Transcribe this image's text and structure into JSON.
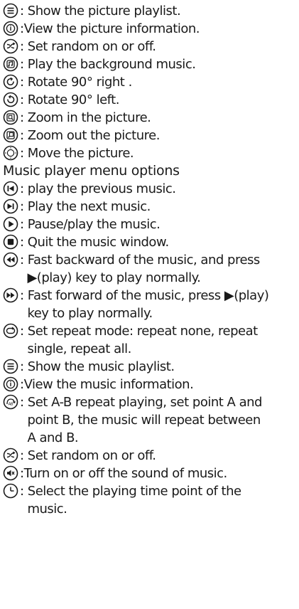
{
  "picture_section": [
    {
      "icon": "playlist-icon",
      "text": ": Show the picture playlist."
    },
    {
      "icon": "info-icon",
      "text": ":View the picture information."
    },
    {
      "icon": "random-icon",
      "text": ": Set random on or off."
    },
    {
      "icon": "music-note-icon",
      "text": ": Play the background music."
    },
    {
      "icon": "rotate-right-icon",
      "text": ": Rotate 90° right ."
    },
    {
      "icon": "rotate-left-icon",
      "text": ": Rotate 90° left."
    },
    {
      "icon": "zoom-in-icon",
      "text": ": Zoom in the picture."
    },
    {
      "icon": "zoom-out-icon",
      "text": ": Zoom out the picture."
    },
    {
      "icon": "move-icon",
      "text": ": Move the picture."
    }
  ],
  "music_heading": "Music player menu options",
  "music_section": [
    {
      "icon": "previous-icon",
      "text": ": play the previous music."
    },
    {
      "icon": "next-icon",
      "text": ": Play the next music."
    },
    {
      "icon": "play-pause-icon",
      "text": ": Pause/play the music."
    },
    {
      "icon": "stop-icon",
      "text": ": Quit the music window."
    },
    {
      "icon": "fast-backward-icon",
      "text": ": Fast backward of the music, and press\n  ▶(play) key to play normally."
    },
    {
      "icon": "fast-forward-icon",
      "text": ": Fast forward of the music, press ▶(play)\n  key to play normally."
    },
    {
      "icon": "repeat-icon",
      "text": ": Set repeat mode: repeat none, repeat\n  single, repeat all."
    },
    {
      "icon": "playlist-icon",
      "text": ": Show the music playlist."
    },
    {
      "icon": "info-icon",
      "text": ":View the music information."
    },
    {
      "icon": "ab-repeat-icon",
      "text": ": Set A-B repeat playing, set point A and\n  point B, the music will repeat between\n  A and B."
    },
    {
      "icon": "random-icon",
      "text": ": Set random on or off."
    },
    {
      "icon": "mute-icon",
      "text": ":Turn on or off the sound of music."
    },
    {
      "icon": "time-point-icon",
      "text": ": Select the playing time point of the\n  music."
    }
  ]
}
